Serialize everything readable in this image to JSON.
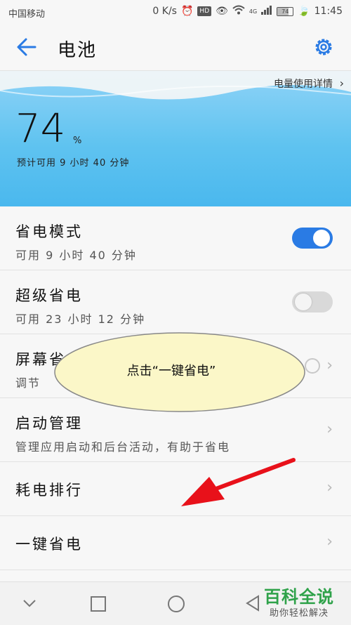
{
  "status_bar": {
    "carrier": "中国移动",
    "speed": "0 K/s",
    "hd": "HD",
    "network": "4G",
    "battery_level": "74",
    "time": "11:45"
  },
  "app_bar": {
    "title": "电池",
    "back_icon": "arrow-left-icon",
    "settings_icon": "gear-icon"
  },
  "battery": {
    "details_link": "电量使用详情",
    "percent": "74",
    "percent_sign": "%",
    "estimate": "预计可用 9 小时 40 分钟",
    "hero_color": "#5fc3f0"
  },
  "settings": [
    {
      "title": "省电模式",
      "subtitle": "可用 9 小时 40 分钟",
      "control": "toggle",
      "on": true
    },
    {
      "title": "超级省电",
      "subtitle": "可用 23 小时 12 分钟",
      "control": "toggle",
      "on": false
    },
    {
      "title": "屏幕省",
      "subtitle": "调节",
      "control": "chevron"
    },
    {
      "title": "启动管理",
      "subtitle": "管理应用启动和后台活动，有助于省电",
      "control": "chevron"
    },
    {
      "title": "耗电排行",
      "control": "chevron"
    },
    {
      "title": "一键省电",
      "control": "chevron"
    }
  ],
  "callout": {
    "text": "点击“一键省电”"
  },
  "nav_bar": {
    "icons": [
      "chevron-down-icon",
      "recent-apps-icon",
      "home-icon",
      "back-triangle-icon"
    ]
  },
  "watermark": {
    "line1": "百科全说",
    "line2": "助你轻松解决"
  },
  "colors": {
    "accent": "#2a7be4",
    "annotation_arrow": "#e8111a",
    "callout_fill": "#fbf7c8"
  }
}
